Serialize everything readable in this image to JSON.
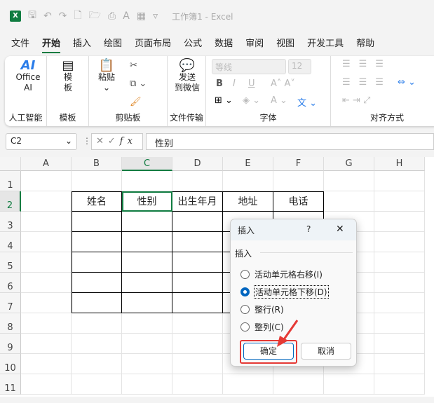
{
  "titlebar": {
    "title": "工作簿1  -  Excel"
  },
  "tabs": [
    "文件",
    "开始",
    "插入",
    "绘图",
    "页面布局",
    "公式",
    "数据",
    "审阅",
    "视图",
    "开发工具",
    "帮助"
  ],
  "ribbon": {
    "ai": {
      "label1": "Office",
      "label2": "AI",
      "group": "人工智能"
    },
    "template": {
      "label1": "模",
      "label2": "板",
      "group": "模板"
    },
    "clipboard": {
      "paste": "粘贴",
      "group": "剪贴板"
    },
    "wechat": {
      "label1": "发送",
      "label2": "到微信",
      "group": "文件传输"
    },
    "font": {
      "name": "等线",
      "size": "12",
      "group": "字体",
      "bold": "B",
      "italic": "I",
      "underline": "U"
    },
    "align": {
      "group": "对齐方式"
    }
  },
  "formula": {
    "cell": "C2",
    "fx": "fx",
    "value": "性别"
  },
  "columns": [
    "A",
    "B",
    "C",
    "D",
    "E",
    "F",
    "G",
    "H"
  ],
  "rows": [
    "1",
    "2",
    "3",
    "4",
    "5",
    "6",
    "7",
    "8",
    "9",
    "10",
    "11"
  ],
  "table_headers": [
    "姓名",
    "性别",
    "出生年月",
    "地址",
    "电话"
  ],
  "dialog": {
    "title": "插入",
    "help": "?",
    "close": "✕",
    "section": "插入",
    "options": [
      "活动单元格右移(I)",
      "活动单元格下移(D)",
      "整行(R)",
      "整列(C)"
    ],
    "selected": 1,
    "ok": "确定",
    "cancel": "取消"
  },
  "colors": {
    "accent": "#107c41",
    "highlight": "#e53935"
  }
}
